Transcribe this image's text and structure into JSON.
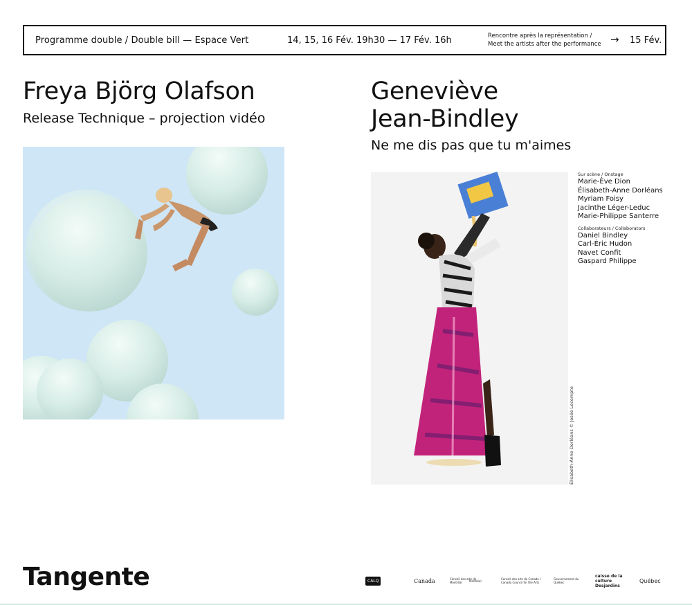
{
  "topbar": {
    "program": "Programme double / Double bill — Espace Vert",
    "dates": "14, 15, 16 Fév. 19h30 — 17 Fév. 16h",
    "meet_fr": "Rencontre après la représentation /",
    "meet_en": "Meet the artists after the performance",
    "arrow": "→",
    "meet_date": "15 Fév."
  },
  "left": {
    "artist": "Freya Björg Olafson",
    "work": "Release Technique – projection vidéo"
  },
  "right": {
    "artist_line1": "Geneviève",
    "artist_line2": "Jean-Bindley",
    "work": "Ne me dis pas que tu m'aimes",
    "onstage_label": "Sur scène / Onstage",
    "onstage": [
      "Marie-Ève Dion",
      "Élisabeth-Anne Dorléans",
      "Myriam Foisy",
      "Jacinthe Léger-Leduc",
      "Marie-Philippe Santerre"
    ],
    "collab_label": "Collaborateurs / Collaborators",
    "collaborators": [
      "Daniel Bindley",
      "Carl-Éric Hudon",
      "Navet Confit",
      "Gaspard Philippe"
    ],
    "photo_credit": "Élisabeth-Anne Dorléans © Josée Lecompte"
  },
  "footer": {
    "logo": "Tangente",
    "sponsors": [
      "CALQ",
      "Canada",
      "Conseil des arts de Montréal",
      "Montréal",
      "Conseil des arts du Canada / Canada Council for the Arts",
      "Gouvernement du Québec",
      "caisse de la culture Desjardins",
      "Québec"
    ]
  },
  "colors": {
    "accent_line": "#cfe9e0",
    "left_image_bg": "#cfe6f7",
    "skirt": "#c2237a"
  }
}
